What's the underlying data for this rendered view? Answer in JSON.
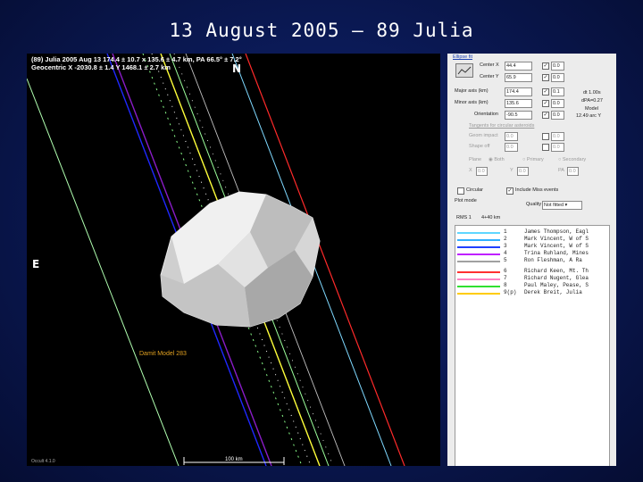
{
  "slide": {
    "title": "13 August 2005 – 89 Julia"
  },
  "plot": {
    "header_line1": "(89) Julia 2005 Aug 13   174.4 ± 10.7 x 135.6 ± 4.7 km, PA 66.5° ± 7.2°",
    "header_line2": "Geocentric X -2030.8 ± 1.4 Y 1468.1 ± 2.7 km",
    "north": "N",
    "east": "E",
    "model_label": "Damit Model 283",
    "corner_label": "Occult 4.1.0",
    "scale_label": "100 km",
    "chord_colors": [
      "#7fd9ff",
      "#1f28ff",
      "#8a1cc8",
      "#c0c0c0",
      "#ff2a2a",
      "#ffff3a",
      "#8cff8c",
      "#ffffff"
    ]
  },
  "panel": {
    "title": "Ellipse fit",
    "center_x_label": "Center X",
    "center_x_value": "44.4",
    "center_x_step": "0.0",
    "center_y_label": "Center Y",
    "center_y_value": "65.9",
    "center_y_step": "0.0",
    "major_label": "Major axis (km)",
    "major_value": "174.4",
    "major_step": "0.1",
    "minor_label": "Minor axis (km)",
    "minor_value": "135.6",
    "minor_step": "0.0",
    "orient_label": "Orientation",
    "orient_value": "-90.5",
    "orient_step": "0.0",
    "side_note1": "dt 1.00s",
    "side_note2": "dPA=0.27",
    "side_note3": "Model",
    "side_note4": "12.49 arc Y",
    "faded1": "Tangents for circular asteroids",
    "faded2": "Geom impact",
    "faded3": "Shape off",
    "faded_step": "0.0",
    "faded_val": "0.0",
    "radio_label": "Plane",
    "radio_a": "Both",
    "radio_b": "Primary",
    "radio_c": "Secondary",
    "axis_row_x": "X",
    "axis_row_y": "Y",
    "axis_row_pa": "PA",
    "axis_row_val": "0.0",
    "circular_label": "Circular",
    "include_miss_label": "Include Miss events",
    "plot_mode_label": "Plot mode",
    "quality_label": "Quality",
    "quality_value": "Not fitted",
    "rms_label": "RMS 1",
    "rms_value": "4+40 km",
    "observers": [
      {
        "num": "1",
        "name": "James Thompson, Eagl",
        "color": "#5fd6ff"
      },
      {
        "num": "2",
        "name": "Mark Vincent, W of S",
        "color": "#30b0ff"
      },
      {
        "num": "3",
        "name": "Mark Vincent, W of S",
        "color": "#2040ff"
      },
      {
        "num": "4",
        "name": "Trina Ruhland, Mines",
        "color": "#c020ff"
      },
      {
        "num": "5",
        "name": "Ron Fleshman, A Ra",
        "color": "#a0a0a0"
      },
      {
        "num": "6",
        "name": "Richard Keen, Mt. Th",
        "color": "#ff3030"
      },
      {
        "num": "7",
        "name": "Richard Nugent, Glea",
        "color": "#ff80c0"
      },
      {
        "num": "8",
        "name": "Paul Maley, Pease, S",
        "color": "#30e030"
      },
      {
        "num": "9(p)",
        "name": "Derek Breit, Julia",
        "color": "#ffcc00"
      }
    ]
  }
}
